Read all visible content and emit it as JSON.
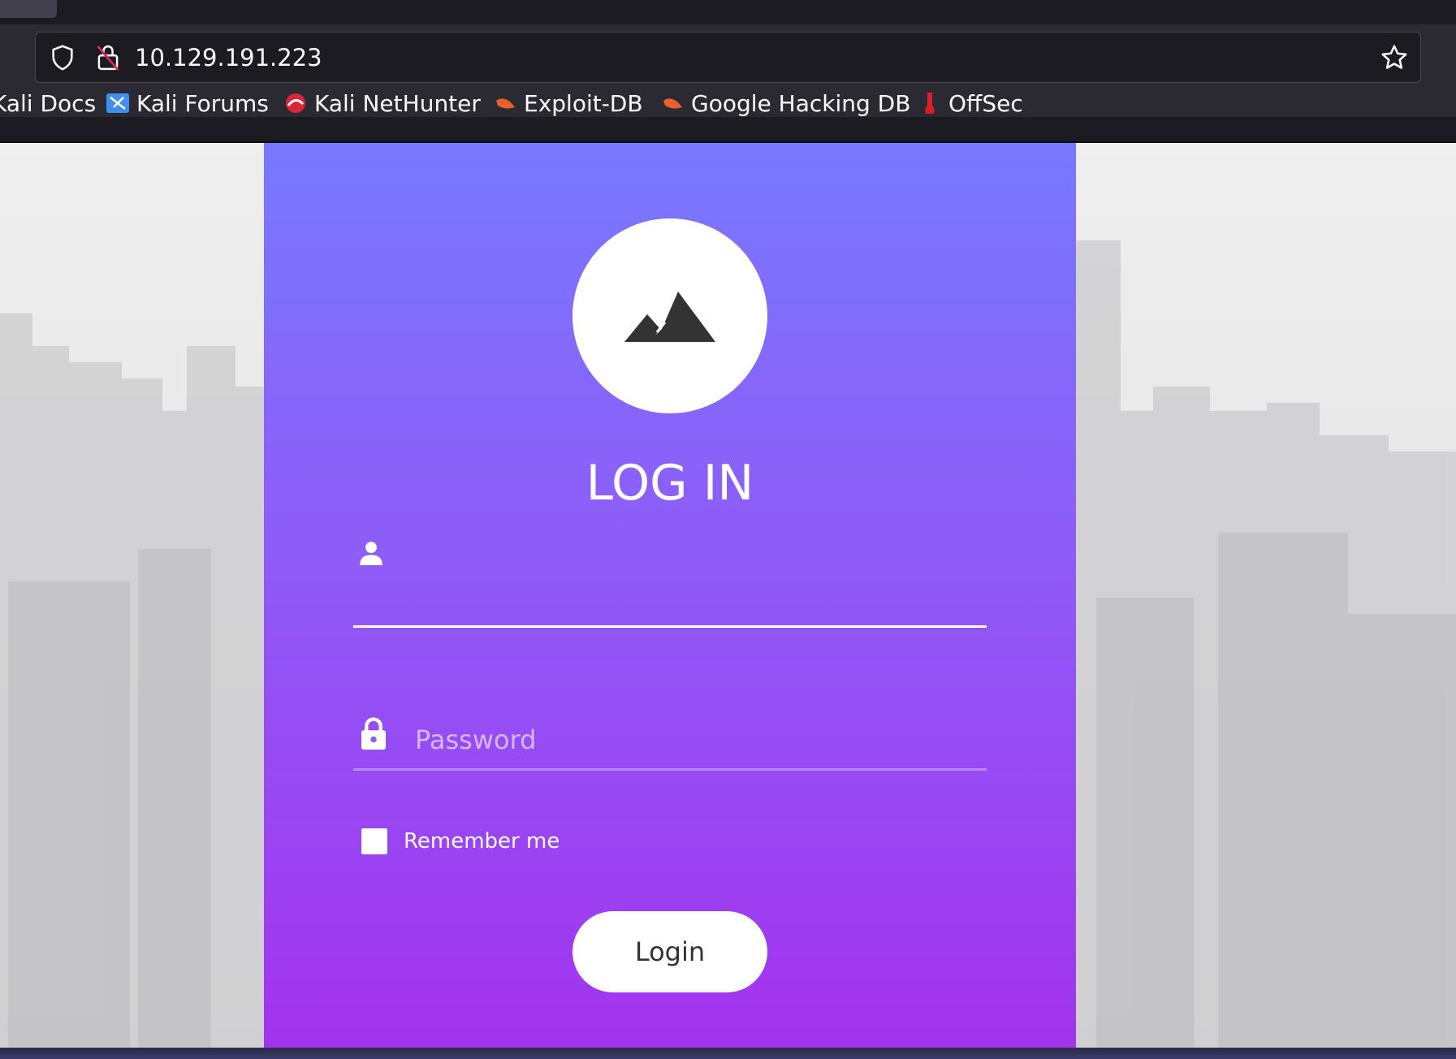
{
  "browser": {
    "url": "10.129.191.223",
    "bookmarks": [
      {
        "label": "Kali Docs",
        "icon": "kali-docs-icon"
      },
      {
        "label": "Kali Forums",
        "icon": "kali-forums-icon"
      },
      {
        "label": "Kali NetHunter",
        "icon": "nethunter-icon"
      },
      {
        "label": "Exploit-DB",
        "icon": "exploit-db-icon"
      },
      {
        "label": "Google Hacking DB",
        "icon": "ghdb-icon"
      },
      {
        "label": "OffSec",
        "icon": "offsec-icon"
      }
    ]
  },
  "login": {
    "title": "LOG IN",
    "username_placeholder": "",
    "password_placeholder": "Password",
    "remember_label": "Remember me",
    "submit_label": "Login"
  },
  "colors": {
    "card_top": "#7878ff",
    "card_bottom": "#a333ee",
    "background": "#e9e9ea"
  }
}
